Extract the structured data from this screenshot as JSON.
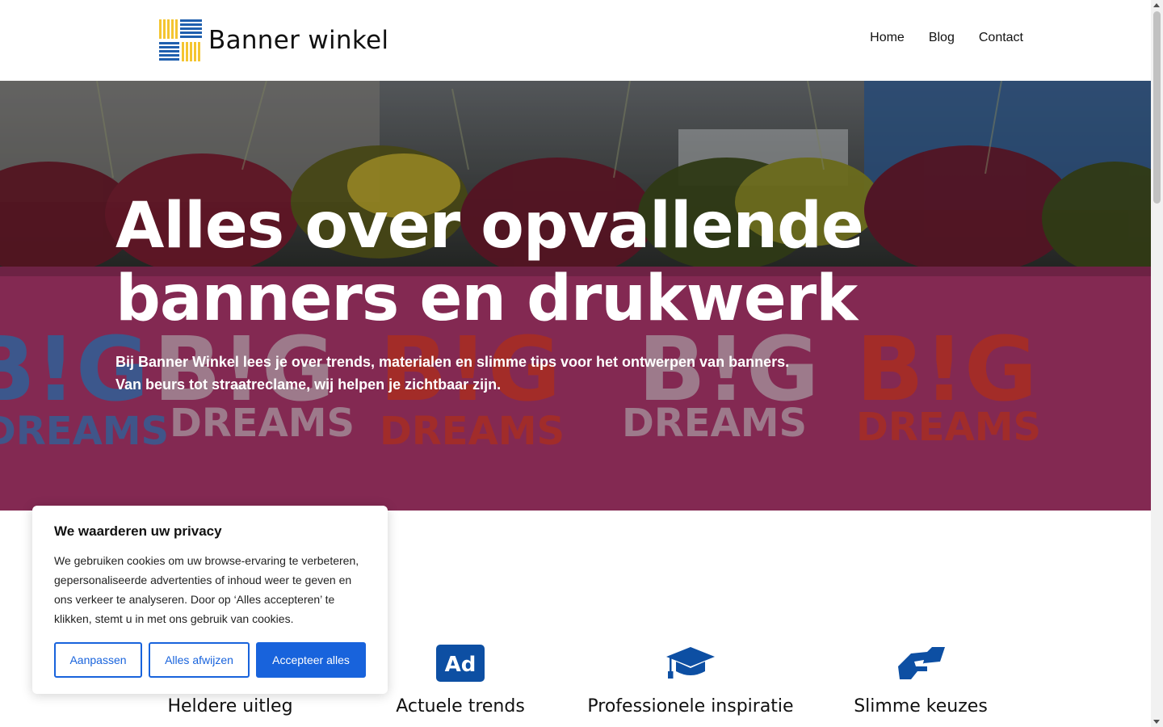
{
  "header": {
    "logo_text": "Banner winkel",
    "logo_icon": "woven-stripes-logo",
    "nav": [
      {
        "label": "Home"
      },
      {
        "label": "Blog"
      },
      {
        "label": "Contact"
      }
    ]
  },
  "hero": {
    "title_line1": "Alles over opvallende",
    "title_line2": "banners en drukwerk",
    "text": "Bij Banner Winkel lees je over trends, materialen en slimme tips voor het ontwerpen van banners. Van beurs tot straatreclame, wij helpen je zichtbaar zijn.",
    "background_wall_text": {
      "big_repeat": "B!G",
      "dreams_repeat": "DREAMS"
    }
  },
  "features": [
    {
      "title": "Heldere uitleg",
      "icon": "info-icon"
    },
    {
      "title": "Actuele trends",
      "icon": "ad-icon"
    },
    {
      "title": "Professionele inspiratie",
      "icon": "graduation-cap-icon"
    },
    {
      "title": "Slimme keuzes",
      "icon": "handshake-icon"
    }
  ],
  "cookie": {
    "title": "We waarderen uw privacy",
    "text": "We gebruiken cookies om uw browse-ervaring te verbeteren, gepersonaliseerde advertenties of inhoud weer te geven en ons verkeer te analyseren. Door op ‘Alles accepteren’ te klikken, stemt u in met ons gebruik van cookies.",
    "customize_label": "Aanpassen",
    "reject_label": "Alles afwijzen",
    "accept_label": "Accepteer alles"
  },
  "colors": {
    "accent": "#1863dc",
    "icon_blue": "#0d4fa3",
    "logo_yellow": "#f4c531",
    "logo_blue": "#1f5fae",
    "wall_pink": "#b03a6e"
  }
}
